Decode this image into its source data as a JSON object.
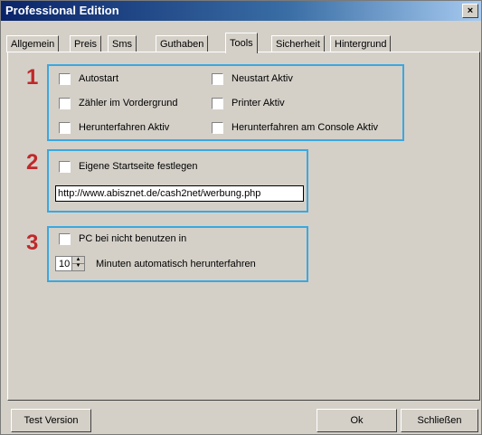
{
  "window": {
    "title": "Professional Edition",
    "close_label": "×"
  },
  "tabs": [
    {
      "label": "Allgemein"
    },
    {
      "label": "Preis"
    },
    {
      "label": "Sms"
    },
    {
      "label": "Guthaben"
    },
    {
      "label": "Tools",
      "active": true
    },
    {
      "label": "Sicherheit"
    },
    {
      "label": "Hintergrund"
    }
  ],
  "groups": {
    "g1": {
      "number": "1",
      "checkboxes": [
        {
          "label": "Autostart",
          "checked": false
        },
        {
          "label": "Neustart Aktiv",
          "checked": false
        },
        {
          "label": "Zähler im Vordergrund",
          "checked": false
        },
        {
          "label": "Printer Aktiv",
          "checked": false
        },
        {
          "label": "Herunterfahren Aktiv",
          "checked": false
        },
        {
          "label": "Herunterfahren am Console Aktiv",
          "checked": false
        }
      ]
    },
    "g2": {
      "number": "2",
      "checkbox": {
        "label": "Eigene Startseite festlegen",
        "checked": false
      },
      "url": "http://www.abisznet.de/cash2net/werbung.php"
    },
    "g3": {
      "number": "3",
      "checkbox": {
        "label": "PC bei nicht benutzen in",
        "checked": false
      },
      "minutes": "10",
      "minutes_text": "Minuten automatisch herunterfahren"
    }
  },
  "buttons": {
    "test_version": "Test Version",
    "ok": "Ok",
    "close": "Schließen"
  },
  "colors": {
    "highlight_border": "#3aa8e0",
    "number_color": "#c0282a",
    "titlebar": "#0a246a"
  }
}
